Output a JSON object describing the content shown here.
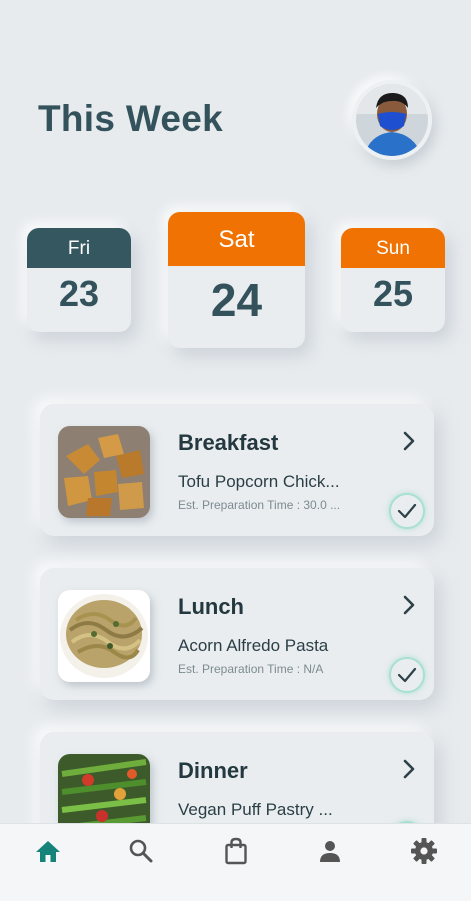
{
  "header": {
    "title": "This Week"
  },
  "days": [
    {
      "name": "Fri",
      "number": "23",
      "color": "#355860"
    },
    {
      "name": "Sat",
      "number": "24",
      "color": "#ef7203"
    },
    {
      "name": "Sun",
      "number": "25",
      "color": "#ef7203"
    }
  ],
  "meals": [
    {
      "label": "Breakfast",
      "dish": "Tofu Popcorn Chick...",
      "prep": "Est. Preparation Time : 30.0 ..."
    },
    {
      "label": "Lunch",
      "dish": "Acorn Alfredo Pasta",
      "prep": "Est. Preparation Time : N/A"
    },
    {
      "label": "Dinner",
      "dish": "Vegan Puff Pastry ..."
    }
  ],
  "nav": {
    "items": [
      "home-icon",
      "search-icon",
      "shopping-bag-icon",
      "person-icon",
      "settings-icon"
    ],
    "active": "home-icon",
    "active_color": "#16837a",
    "inactive_color": "#555555"
  }
}
